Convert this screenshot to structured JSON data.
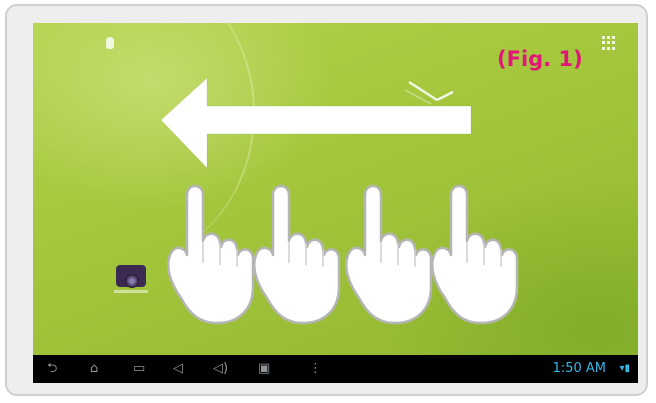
{
  "figure": {
    "label": "(Fig. 1)"
  },
  "gesture": {
    "direction": "left",
    "fingers": 4
  },
  "colors": {
    "label": "#e2157a",
    "wallpaper": "#a2c53b",
    "navbar": "#000000",
    "clock": "#33b5e5",
    "arrow": "#ffffff"
  },
  "status_bar": {
    "time": "1:50 AM",
    "icons": [
      "wifi-icon",
      "battery-icon"
    ]
  },
  "nav_buttons": [
    {
      "name": "back-button",
      "icon": "back-arrow-icon",
      "glyph": "⮌"
    },
    {
      "name": "home-button",
      "icon": "home-icon",
      "glyph": "⌂"
    },
    {
      "name": "recent-apps-button",
      "icon": "recent-apps-icon",
      "glyph": "▭"
    },
    {
      "name": "volume-down-button",
      "icon": "volume-down-icon",
      "glyph": "◁"
    },
    {
      "name": "volume-up-button",
      "icon": "volume-up-icon",
      "glyph": "◁)"
    },
    {
      "name": "screenshot-button",
      "icon": "screenshot-icon",
      "glyph": "▣"
    },
    {
      "name": "menu-button",
      "icon": "menu-dots-icon",
      "glyph": "⋮"
    }
  ],
  "home_screen": {
    "apps": [
      {
        "name": "camera-app",
        "icon": "camera-icon"
      }
    ]
  }
}
